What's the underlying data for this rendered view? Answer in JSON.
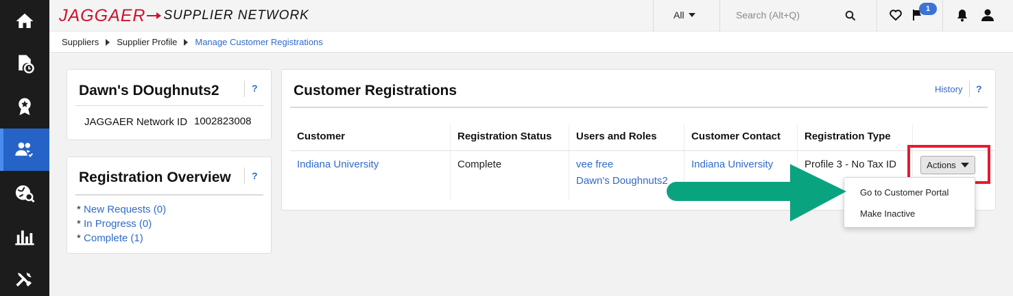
{
  "nav": {
    "items": [
      {
        "name": "home"
      },
      {
        "name": "documents-clock"
      },
      {
        "name": "award"
      },
      {
        "name": "users-check",
        "active": true
      },
      {
        "name": "globe-search"
      },
      {
        "name": "analytics"
      },
      {
        "name": "tools"
      }
    ]
  },
  "header": {
    "logo_brand": "JAGGAER",
    "logo_sub": "SUPPLIER NETWORK",
    "scope_value": "All",
    "search_placeholder": "Search (Alt+Q)",
    "notification_count": "1",
    "colors": {
      "brand": "#d0102b",
      "accent": "#2f6ac9",
      "badge": "#3a73d6"
    }
  },
  "breadcrumb": {
    "items": [
      "Suppliers",
      "Supplier Profile"
    ],
    "current": "Manage Customer Registrations"
  },
  "supplier_panel": {
    "name": "Dawn's DOughnuts2",
    "help": "?",
    "id_label": "JAGGAER Network ID",
    "id_value": "1002823008"
  },
  "overview_panel": {
    "title": "Registration Overview",
    "help": "?",
    "bullet": "*",
    "items": [
      "New Requests (0)",
      "In Progress (0)",
      "Complete (1)"
    ]
  },
  "registrations_panel": {
    "title": "Customer Registrations",
    "history_label": "History",
    "help": "?",
    "columns": [
      "Customer",
      "Registration Status",
      "Users and Roles",
      "Customer Contact",
      "Registration Type"
    ],
    "rows": [
      {
        "customer": "Indiana University",
        "status": "Complete",
        "users": [
          "vee free",
          "Dawn's Doughnuts2"
        ],
        "contact": "Indiana University",
        "type": "Profile 3 - No Tax ID"
      }
    ],
    "actions_label": "Actions",
    "actions_menu": [
      "Go to Customer Portal",
      "Make Inactive"
    ]
  },
  "annotation": {
    "highlight_color": "#e8192c",
    "arrow_color": "#0aa37f"
  }
}
